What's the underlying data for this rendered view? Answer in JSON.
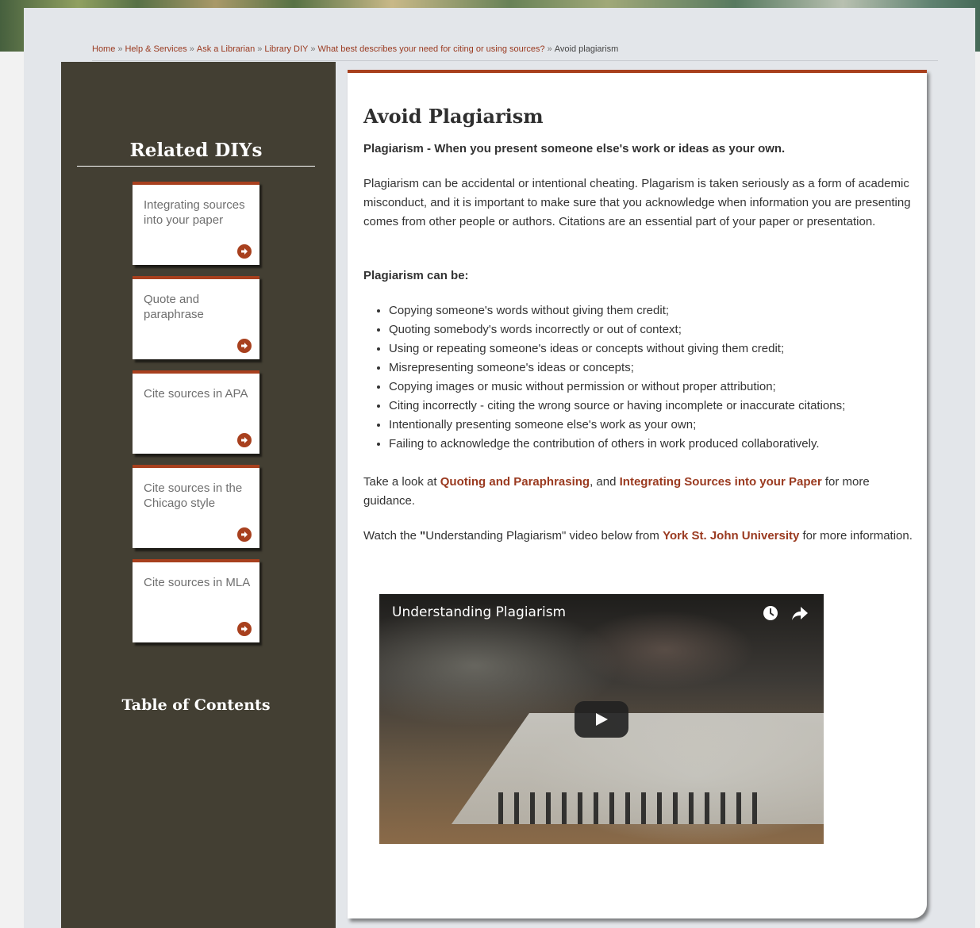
{
  "breadcrumb": {
    "items": [
      "Home",
      "Help & Services",
      "Ask a Librarian",
      "Library DIY",
      "What best describes your need for citing or using sources?"
    ],
    "separator": "»",
    "current": "Avoid plagiarism"
  },
  "sidebar": {
    "related_title": "Related DIYs",
    "cards": [
      {
        "label": "Integrating sources into your paper"
      },
      {
        "label": "Quote and paraphrase"
      },
      {
        "label": "Cite sources in APA"
      },
      {
        "label": "Cite sources in the Chicago style"
      },
      {
        "label": "Cite sources in MLA"
      }
    ],
    "toc_title": "Table of Contents"
  },
  "main": {
    "title": "Avoid Plagiarism",
    "definition": "Plagiarism - When you present someone else's work or ideas as your own.",
    "intro": "Plagiarism can be accidental or intentional cheating. Plagarism is taken seriously as a form of academic misconduct, and it is important to make sure that you acknowledge when information you are presenting comes from other people or authors. Citations are an essential part of your paper or presentation.",
    "list_heading": "Plagiarism can be:",
    "list": [
      "Copying someone's words without giving them credit;",
      "Quoting somebody's words incorrectly or out of context;",
      "Using or repeating someone's ideas or concepts without giving them credit;",
      "Misrepresenting someone's ideas or concepts;",
      "Copying images or music without permission or without proper attribution;",
      "Citing incorrectly - citing the wrong source or having incomplete or inaccurate citations;",
      "Intentionally presenting someone else's work as your own;",
      "Failing to acknowledge the contribution of others in work produced collaboratively."
    ],
    "guidance": {
      "before": "Take a look at ",
      "link1": "Quoting and Paraphrasing",
      "middle": ", and ",
      "link2": "Integrating Sources into your Paper",
      "after": " for more guidance."
    },
    "watch": {
      "before": "Watch the ",
      "quote": "\"",
      "mid": "Understanding Plagiarism\" video below from ",
      "link": "York St. John University",
      "after": " for more information."
    },
    "video": {
      "title": "Understanding Plagiarism",
      "icons": [
        "clock-icon",
        "share-icon",
        "play-icon"
      ]
    }
  },
  "colors": {
    "accent": "#a8401e",
    "sidebar_bg": "#433f33",
    "page_bg": "#e3e6ea",
    "link": "#9a3a20"
  }
}
